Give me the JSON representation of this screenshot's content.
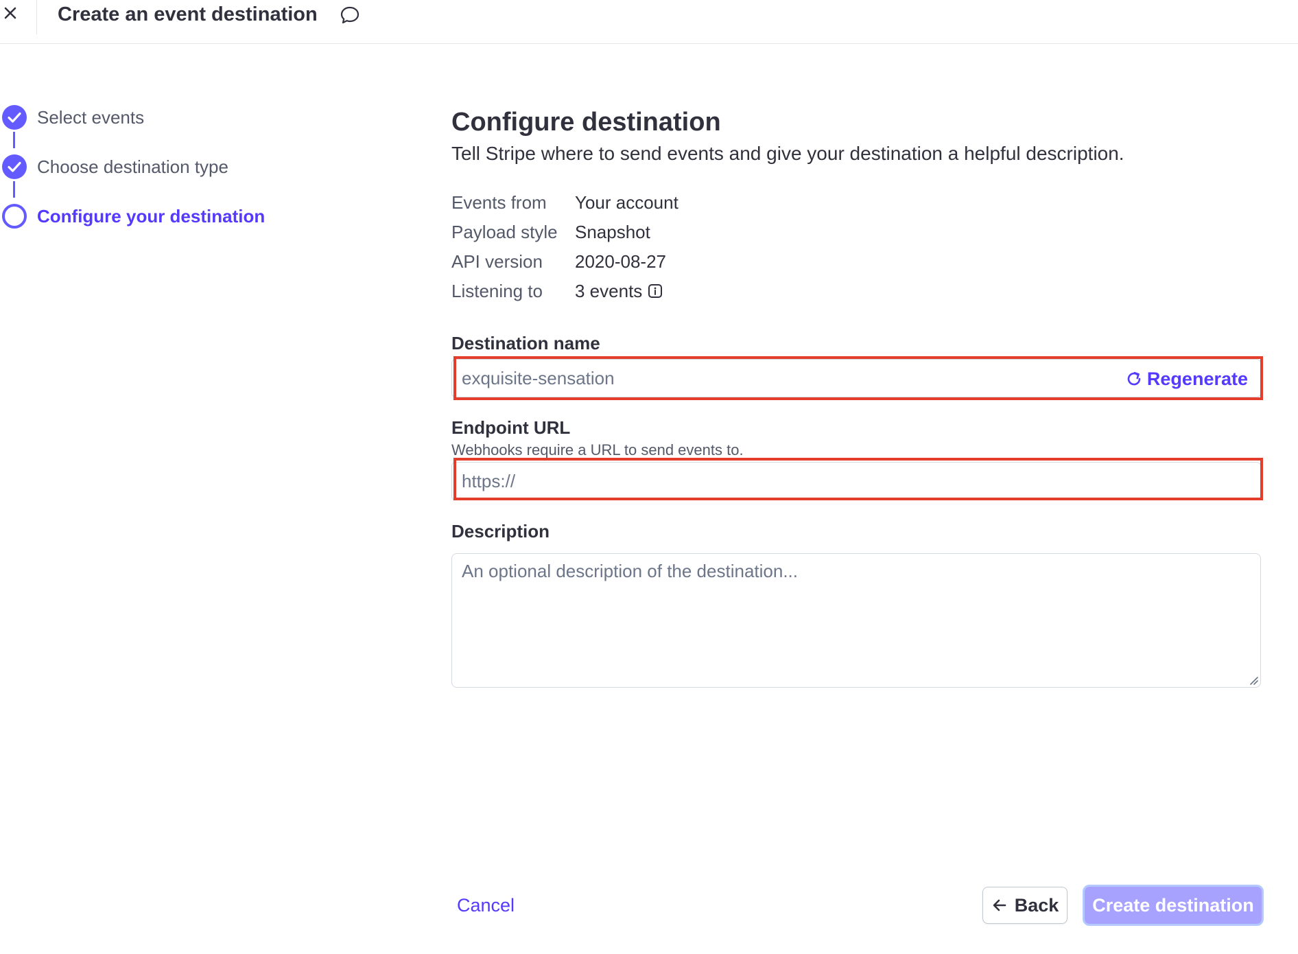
{
  "header": {
    "title": "Create an event destination"
  },
  "stepper": {
    "steps": [
      {
        "label": "Select events",
        "status": "done"
      },
      {
        "label": "Choose destination type",
        "status": "done"
      },
      {
        "label": "Configure your destination",
        "status": "current"
      }
    ]
  },
  "main": {
    "title": "Configure destination",
    "subtitle": "Tell Stripe where to send events and give your destination a helpful description.",
    "summary": [
      {
        "key": "Events from",
        "value": "Your account"
      },
      {
        "key": "Payload style",
        "value": "Snapshot"
      },
      {
        "key": "API version",
        "value": "2020-08-27"
      },
      {
        "key": "Listening to",
        "value": "3 events"
      }
    ],
    "destination_name": {
      "label": "Destination name",
      "placeholder": "exquisite-sensation",
      "regenerate_label": "Regenerate"
    },
    "endpoint_url": {
      "label": "Endpoint URL",
      "help": "Webhooks require a URL to send events to.",
      "placeholder": "https://"
    },
    "description": {
      "label": "Description",
      "placeholder": "An optional description of the destination..."
    }
  },
  "footer": {
    "cancel_label": "Cancel",
    "back_label": "Back",
    "create_label": "Create destination"
  },
  "colors": {
    "accent": "#533afd",
    "step_accent": "#635bff",
    "highlight": "#e43d2b",
    "create_button_bg": "#a8a2ff"
  },
  "icons": [
    "close-icon",
    "feedback-icon",
    "check-icon",
    "info-icon",
    "refresh-icon",
    "arrow-left-icon",
    "resize-handle-icon"
  ]
}
